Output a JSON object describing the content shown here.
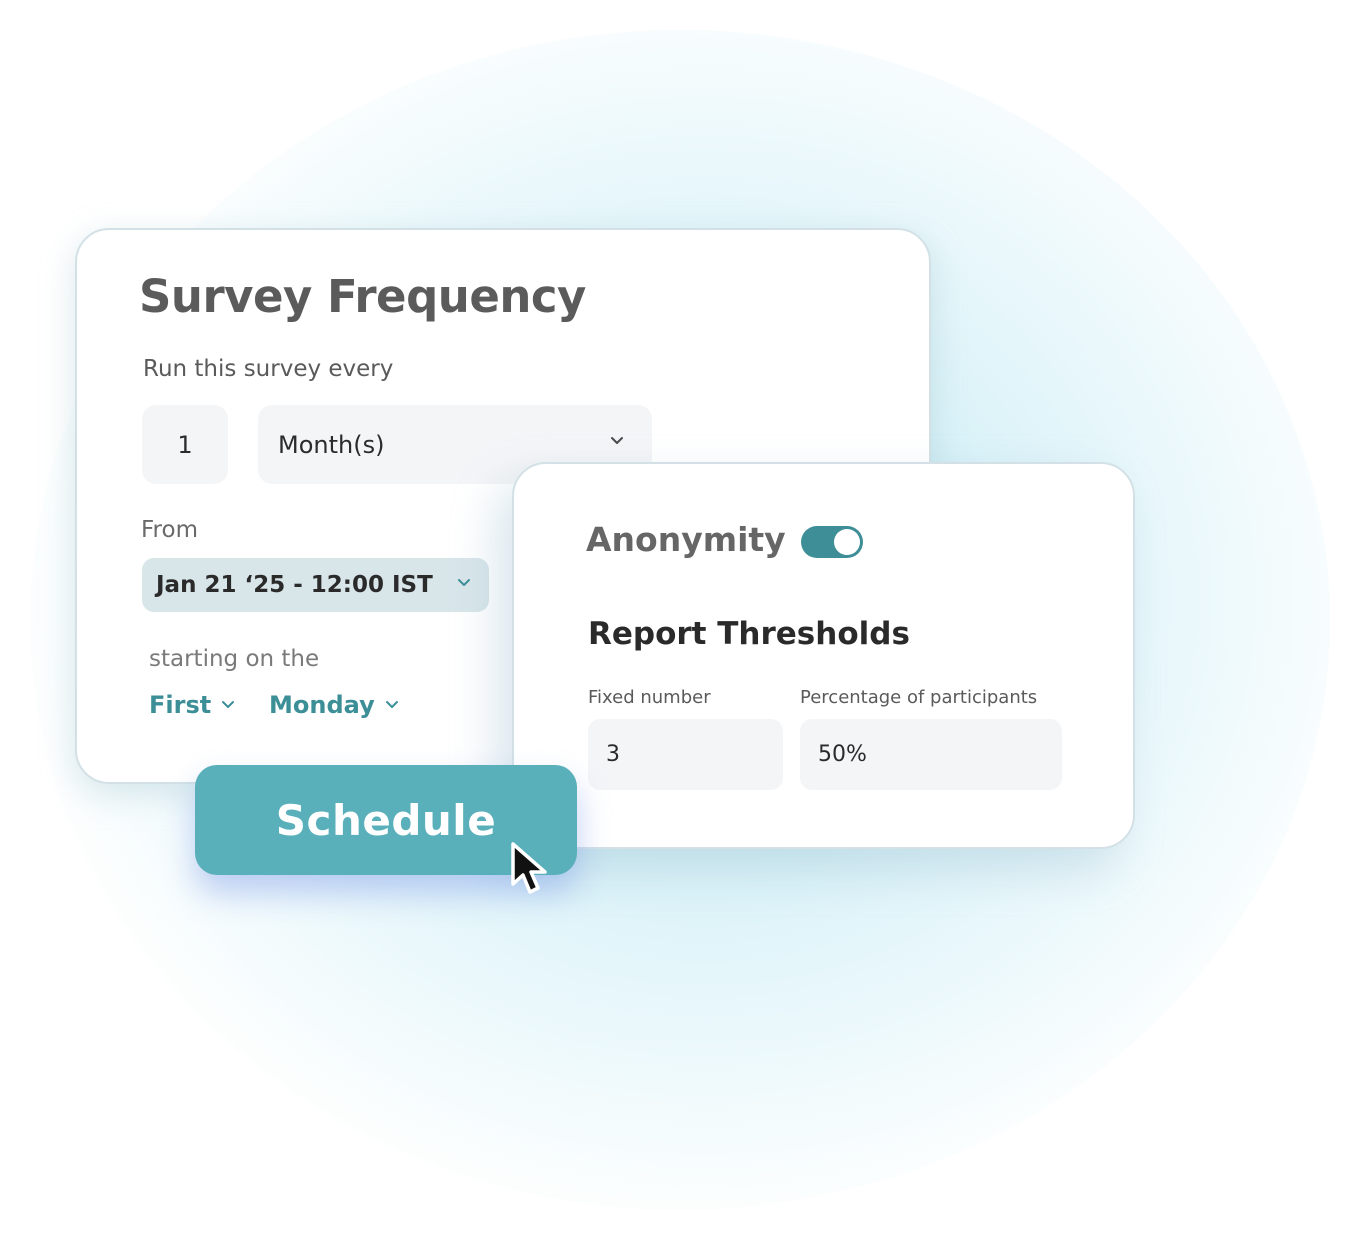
{
  "survey_frequency": {
    "title": "Survey Frequency",
    "run_label": "Run this survey every",
    "interval_value": "1",
    "interval_unit": "Month(s)",
    "from_label": "From",
    "start_datetime": "Jan 21 ‘25 - 12:00 IST",
    "starting_on_label": "starting on the",
    "week_occurrence": "First",
    "weekday": "Monday"
  },
  "privacy": {
    "anonymity_label": "Anonymity",
    "anonymity_enabled": true,
    "report_thresholds_title": "Report Thresholds",
    "fixed_number_label": "Fixed number",
    "fixed_number_value": "3",
    "percentage_label": "Percentage of participants",
    "percentage_value": "50%"
  },
  "actions": {
    "schedule_label": "Schedule"
  },
  "colors": {
    "accent": "#3e8e97",
    "button": "#59b0bb",
    "date_field_bg": "#d8e6ea",
    "input_bg": "#f4f5f7"
  },
  "icons": [
    "chevron-down-icon",
    "mouse-cursor-icon"
  ]
}
